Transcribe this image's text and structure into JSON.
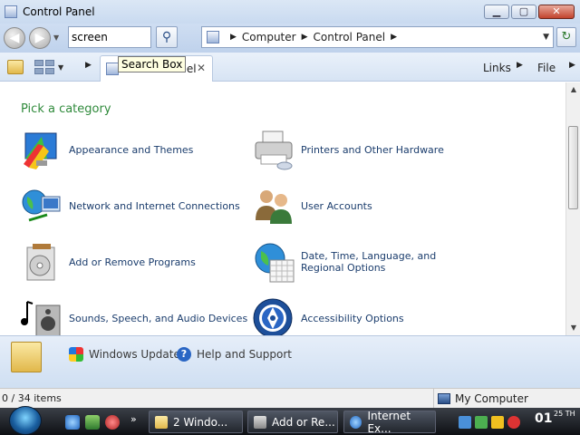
{
  "window": {
    "title": "Control Panel",
    "minimize": "▁",
    "maximize": "▢",
    "close": "✕"
  },
  "nav": {
    "back": "◀",
    "forward": "▶",
    "search_value": "screen",
    "breadcrumbs": [
      "Computer",
      "Control Panel"
    ],
    "go_icon": "go-refresh-icon"
  },
  "tab": {
    "label": "Control Panel",
    "tooltip": "Search Box"
  },
  "menu": {
    "links": "Links",
    "file": "File"
  },
  "content": {
    "heading": "Pick a category",
    "categories": [
      {
        "label": "Appearance and Themes",
        "icon": "appearance-themes-icon"
      },
      {
        "label": "Printers and Other Hardware",
        "icon": "printer-icon"
      },
      {
        "label": "Network and Internet Connections",
        "icon": "network-icon"
      },
      {
        "label": "User Accounts",
        "icon": "user-accounts-icon"
      },
      {
        "label": "Add or Remove Programs",
        "icon": "add-remove-programs-icon"
      },
      {
        "label": "Date, Time, Language, and Regional Options",
        "icon": "date-time-globe-icon"
      },
      {
        "label": "Sounds, Speech, and Audio Devices",
        "icon": "speaker-icon"
      },
      {
        "label": "Accessibility Options",
        "icon": "accessibility-icon"
      }
    ]
  },
  "bottom": {
    "windows_update": "Windows Update",
    "help_support": "Help and Support"
  },
  "status": {
    "items": "0 / 34 items",
    "location": "My Computer"
  },
  "taskbar": {
    "buttons": [
      {
        "label": "2 Windo..."
      },
      {
        "label": "Add or Re..."
      },
      {
        "label": "Internet Ex..."
      }
    ],
    "more": "»",
    "clock": "01",
    "clock_sup": "25 TH"
  }
}
